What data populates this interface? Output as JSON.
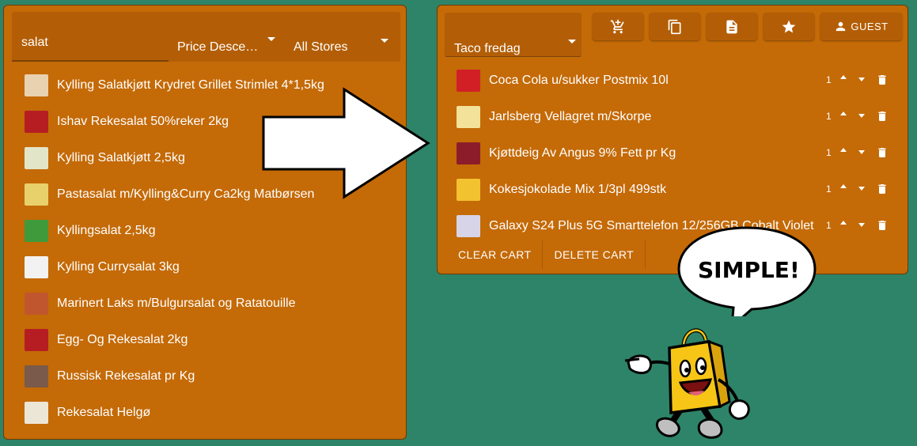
{
  "search": {
    "value": "salat",
    "placeholder": ""
  },
  "sort": {
    "selected": "Price Desce…"
  },
  "store_filter": {
    "selected": "All Stores"
  },
  "results": [
    {
      "label": "Kylling Salatkjøtt Krydret Grillet Strimlet 4*1,5kg",
      "thumb_color": "#e8d2b0"
    },
    {
      "label": "Ishav Rekesalat 50%reker 2kg",
      "thumb_color": "#b51d23"
    },
    {
      "label": "Kylling Salatkjøtt 2,5kg",
      "thumb_color": "#e3e5c8"
    },
    {
      "label": "Pastasalat m/Kylling&Curry Ca2kg Matbørsen",
      "thumb_color": "#e8d06a"
    },
    {
      "label": "Kyllingsalat 2,5kg",
      "thumb_color": "#3f9a3c"
    },
    {
      "label": "Kylling Currysalat 3kg",
      "thumb_color": "#f2f2f2"
    },
    {
      "label": "Marinert Laks m/Bulgursalat og Ratatouille",
      "thumb_color": "#c0562d"
    },
    {
      "label": "Egg- Og Rekesalat 2kg",
      "thumb_color": "#b51d23"
    },
    {
      "label": "Russisk Rekesalat pr Kg",
      "thumb_color": "#7a5a4a"
    },
    {
      "label": "Rekesalat Helgø",
      "thumb_color": "#ece6d6"
    }
  ],
  "cart": {
    "selected": "Taco fredag",
    "guest_label": "GUEST",
    "items": [
      {
        "name": "Coca Cola u/sukker Postmix 10l",
        "qty": "1",
        "thumb_color": "#d11f26"
      },
      {
        "name": "Jarlsberg Vellagret m/Skorpe",
        "qty": "1",
        "thumb_color": "#f3e29a"
      },
      {
        "name": "Kjøttdeig Av Angus 9% Fett pr Kg",
        "qty": "1",
        "thumb_color": "#8c1c2a"
      },
      {
        "name": "Kokesjokolade Mix 1/3pl 499stk",
        "qty": "1",
        "thumb_color": "#f2c230"
      },
      {
        "name": "Galaxy S24 Plus 5G Smarttelefon 12/256GB Cobalt Violet",
        "qty": "1",
        "thumb_color": "#d8d4e8"
      }
    ],
    "clear_label": "CLEAR CART",
    "delete_label": "DELETE CART"
  },
  "bubble_text": "SIMPLE!",
  "colors": {
    "background": "#2e8468",
    "panel": "#c46a07",
    "input_bg": "#b35e06"
  },
  "icons": [
    "add-shopping-cart-icon",
    "copy-icon",
    "document-icon",
    "star-icon",
    "person-icon",
    "trash-icon"
  ]
}
